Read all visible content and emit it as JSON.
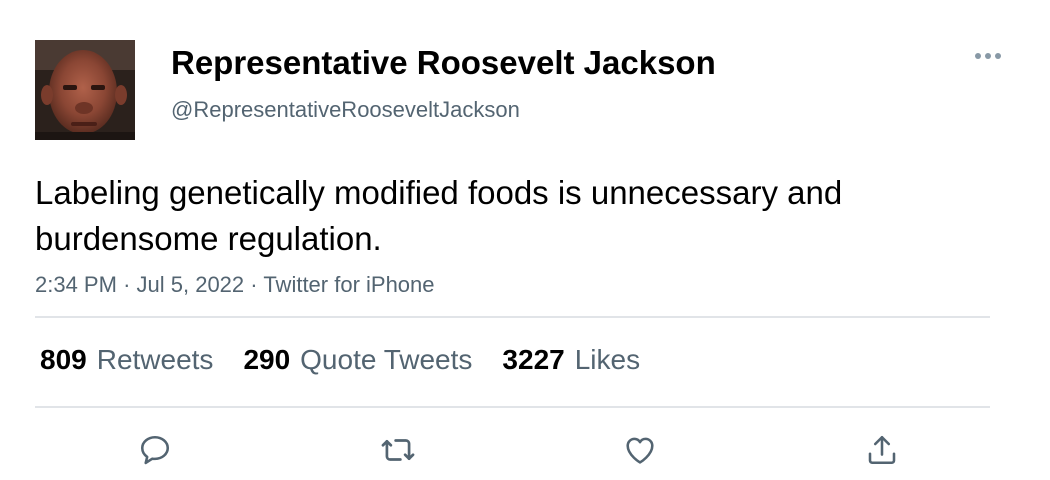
{
  "tweet": {
    "author": {
      "display_name": "Representative Roosevelt Jackson",
      "handle": "@RepresentativeRooseveltJackson"
    },
    "text": "Labeling genetically modified foods is unnecessary and burdensome regulation.",
    "time": "2:34 PM",
    "separator": "·",
    "date": "Jul 5, 2022",
    "source": "Twitter for iPhone"
  },
  "stats": {
    "retweets": {
      "count": "809",
      "label": "Retweets"
    },
    "quote_tweets": {
      "count": "290",
      "label": "Quote Tweets"
    },
    "likes": {
      "count": "3227",
      "label": "Likes"
    }
  },
  "icons": {
    "more": "more-horizontal-icon",
    "reply": "reply-icon",
    "retweet": "retweet-icon",
    "like": "heart-icon",
    "share": "share-icon"
  },
  "colors": {
    "text_primary": "#000000",
    "text_secondary": "#536471",
    "divider": "#e1e4e8",
    "icon": "#536471"
  }
}
